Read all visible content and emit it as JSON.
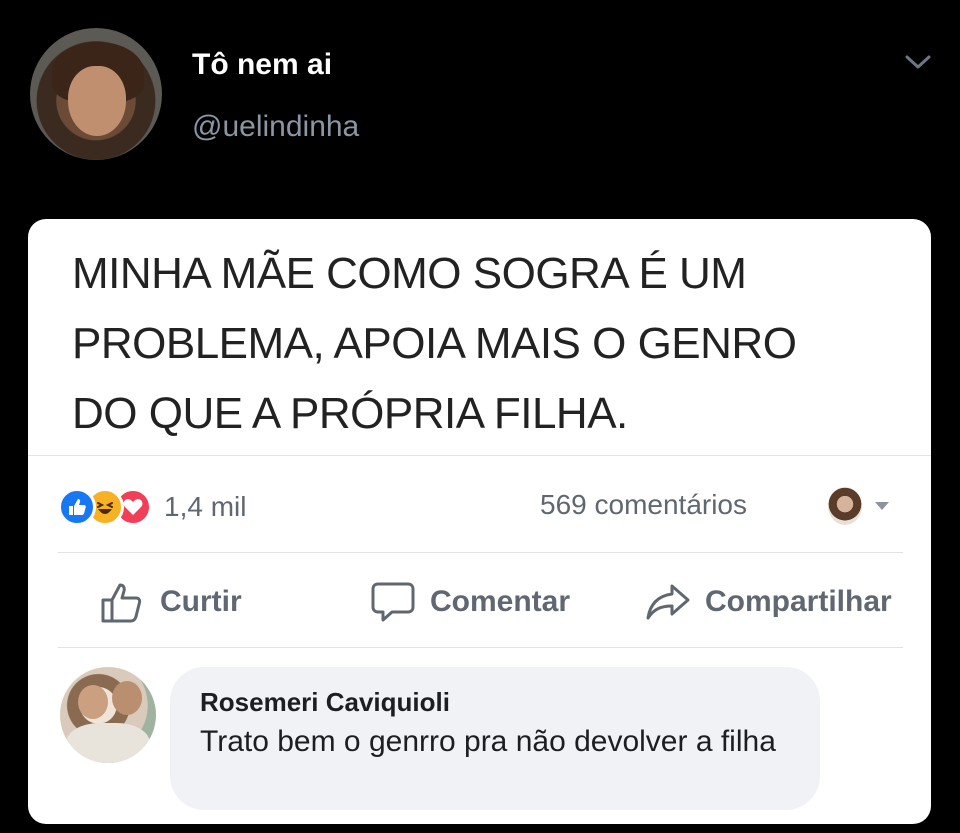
{
  "tweet": {
    "display_name": "Tô nem ai",
    "handle": "@uelindinha"
  },
  "post": {
    "text": "MINHA MÃE COMO SOGRA É UM\nPROBLEMA, APOIA MAIS O GENRO\nDO QUE A PRÓPRIA FILHA.",
    "reactions": {
      "icons": [
        "like-icon",
        "haha-icon",
        "love-icon"
      ],
      "count": "1,4 mil"
    },
    "comments_count": "569 comentários",
    "actions": {
      "like": "Curtir",
      "comment": "Comentar",
      "share": "Compartilhar"
    }
  },
  "comment": {
    "author": "Rosemeri Caviquioli",
    "text": "Trato bem o genrro pra não devolver a filha"
  },
  "colors": {
    "background": "#000000",
    "card": "#ffffff",
    "like_blue": "#1877f2",
    "haha_yellow": "#f7b125",
    "love_red": "#f33e58",
    "muted_text": "#606770",
    "handle_gray": "#8b96a3"
  }
}
